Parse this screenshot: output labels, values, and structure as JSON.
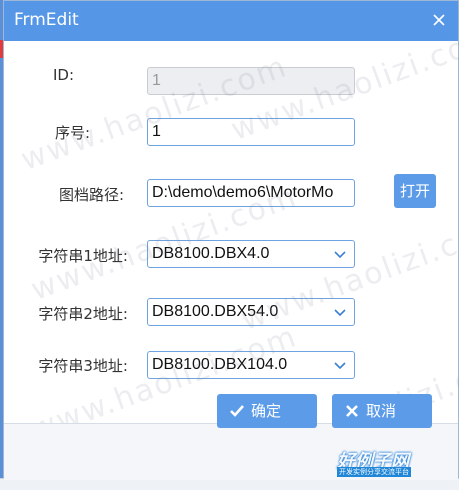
{
  "window": {
    "title": "FrmEdit"
  },
  "form": {
    "id": {
      "label": "ID:",
      "value": "1"
    },
    "seq": {
      "label": "序号:",
      "value": "1"
    },
    "path": {
      "label": "图档路径:",
      "value": "D:\\demo\\demo6\\MotorMo"
    },
    "str1": {
      "label": "字符串1地址:",
      "value": "DB8100.DBX4.0"
    },
    "str2": {
      "label": "字符串2地址:",
      "value": "DB8100.DBX54.0"
    },
    "str3": {
      "label": "字符串3地址:",
      "value": "DB8100.DBX104.0"
    }
  },
  "buttons": {
    "open": "打开",
    "ok": "确定",
    "cancel": "取消"
  },
  "watermark": {
    "text": "www.haolizi.com",
    "logo": "好例子网",
    "logo_sub": "开发实例分享交流平台"
  },
  "colors": {
    "titlebar": "#5596e6",
    "button": "#5c9be8",
    "field_border": "#6fa3e0"
  },
  "icons": {
    "close": "close-icon",
    "dropdown": "chevron-down-icon",
    "ok": "check-icon",
    "cancel": "x-icon"
  }
}
